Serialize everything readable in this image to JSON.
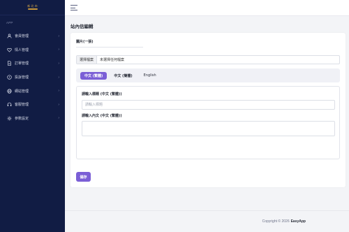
{
  "sidebar": {
    "logo_text": "新 北 市",
    "section_label": "APP",
    "items": [
      {
        "label": "會員管理",
        "icon": "user-icon"
      },
      {
        "label": "情人管理",
        "icon": "heart-icon"
      },
      {
        "label": "訂單管理",
        "icon": "document-icon"
      },
      {
        "label": "投訴管理",
        "icon": "warning-circle-icon"
      },
      {
        "label": "網站管理",
        "icon": "globe-icon"
      },
      {
        "label": "客服管理",
        "icon": "headset-icon"
      },
      {
        "label": "參數設定",
        "icon": "gear-icon"
      }
    ]
  },
  "page": {
    "title": "站內信編輯"
  },
  "form": {
    "image_label": "圖片(一張)",
    "file_button": "選擇檔案",
    "file_name": "未選擇任何檔案",
    "tabs": [
      {
        "label": "中文 (繁體)",
        "active": true
      },
      {
        "label": "中文 (簡體)",
        "active": false
      },
      {
        "label": "English",
        "active": false
      }
    ],
    "title_label": "請輸入標題 (中文 (繁體))",
    "title_placeholder": "請輸入標題",
    "content_label": "請輸入內文 (中文 (繁體))",
    "content_value": "",
    "save_label": "儲存"
  },
  "footer": {
    "copyright": "Copyright © 2026",
    "brand": "EasyApp"
  },
  "colors": {
    "sidebar_bg": "#111c44",
    "accent": "#7b5fd6",
    "page_bg": "#f3f4f7"
  }
}
